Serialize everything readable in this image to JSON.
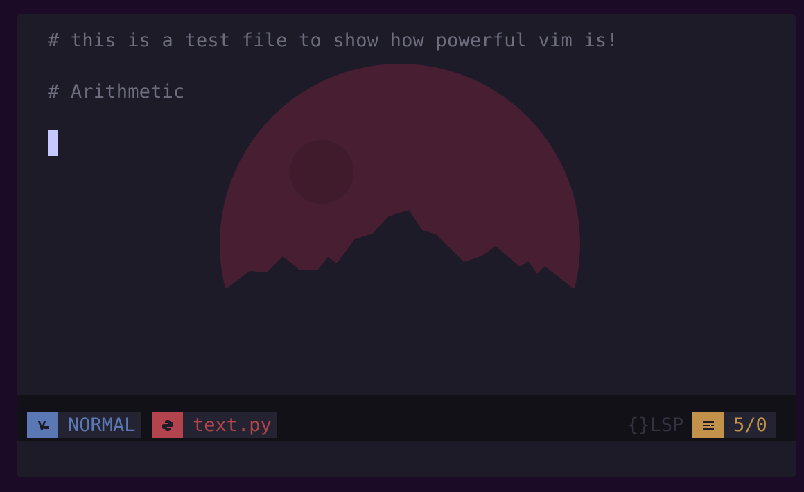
{
  "editor": {
    "lines": [
      "# this is a test file to show how powerful vim is!",
      "# Arithmetic"
    ]
  },
  "statusbar": {
    "mode": "NORMAL",
    "filename": "text.py",
    "lsp_label": "LSP",
    "position": "5/0"
  },
  "colors": {
    "mode": "#5b78b4",
    "file": "#b3434d",
    "position": "#c2924a",
    "cursor": "#c5c9ff"
  },
  "icons": {
    "mode": "vim-logo-icon",
    "file": "python-icon",
    "lsp": "lsp-braces-icon",
    "position": "lines-icon"
  }
}
